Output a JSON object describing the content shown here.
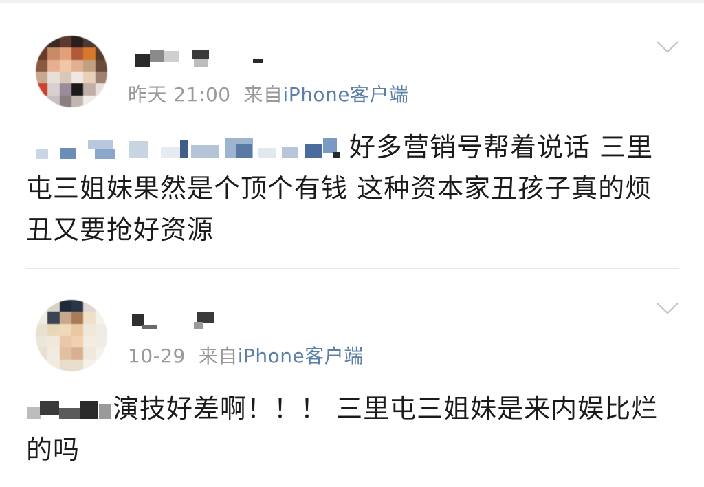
{
  "posts": [
    {
      "meta": {
        "time": "昨天 21:00",
        "from": "来自",
        "source": "iPhone客户端"
      },
      "text": "好多营销号帮着说话 三里屯三姐妹果然是个顶个有钱 这种资本家丑孩子真的烦 丑又要抢好资源"
    },
    {
      "meta": {
        "time": "10-29",
        "from": "来自",
        "source": "iPhone客户端"
      },
      "text": "演技好差啊！！！ 三里屯三姐妹是来内娱比烂的吗"
    }
  ],
  "icons": {
    "more": "chevron-down-icon",
    "avatar": "user-avatar"
  },
  "colors": {
    "meta_gray": "#9a9a9a",
    "source_blue": "#5b7fa8",
    "text": "#1b1b1b"
  }
}
